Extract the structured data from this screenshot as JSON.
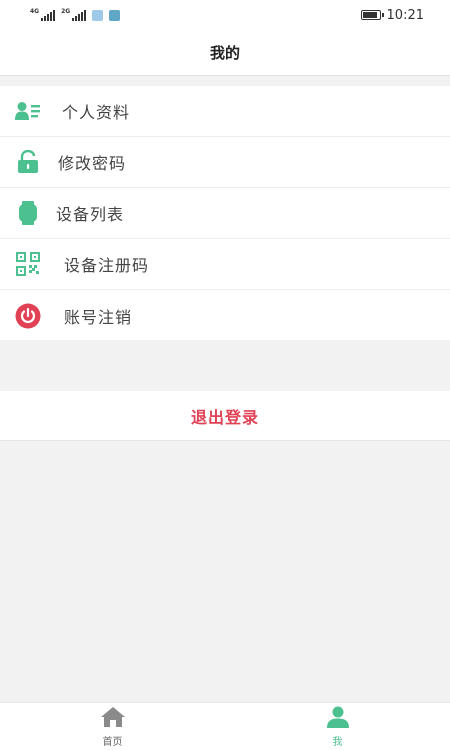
{
  "status_bar": {
    "network_1": "4G",
    "network_2": "2G",
    "time": "10:21"
  },
  "header": {
    "title": "我的"
  },
  "menu": {
    "items": [
      {
        "label": "个人资料",
        "icon": "user-profile-icon"
      },
      {
        "label": "修改密码",
        "icon": "lock-icon"
      },
      {
        "label": "设备列表",
        "icon": "watch-icon"
      },
      {
        "label": "设备注册码",
        "icon": "qr-code-icon"
      },
      {
        "label": "账号注销",
        "icon": "power-icon"
      }
    ]
  },
  "logout": {
    "label": "退出登录"
  },
  "tabbar": {
    "tabs": [
      {
        "label": "首页",
        "icon": "home-icon",
        "active": false
      },
      {
        "label": "我",
        "icon": "person-icon",
        "active": true
      }
    ]
  },
  "colors": {
    "accent": "#4cc08f",
    "danger": "#e04155",
    "background": "#f2f2f2"
  }
}
